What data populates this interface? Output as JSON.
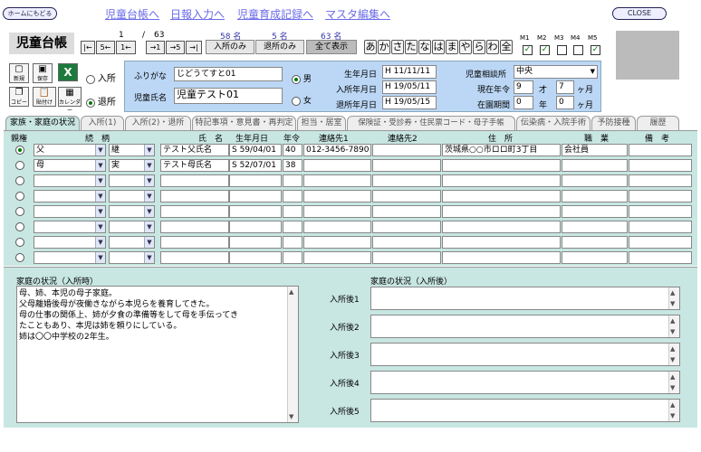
{
  "header": {
    "home_label": "ホームにもどる",
    "close_label": "CLOSE",
    "links": [
      "児童台帳へ",
      "日報入力へ",
      "児童育成記録へ",
      "マスタ編集へ"
    ]
  },
  "title": "児童台帳",
  "paging": {
    "current": "1",
    "sep": "/",
    "total": "63",
    "btn_first": "|←",
    "btn_back5": "5←",
    "btn_prev": "1←",
    "btn_next": "→1",
    "btn_fwd5": "→5",
    "btn_last": "→|"
  },
  "filters": [
    {
      "count": "58 名",
      "label": "入所のみ"
    },
    {
      "count": "5 名",
      "label": "退所のみ"
    },
    {
      "count": "63 名",
      "label": "全て表示"
    }
  ],
  "kana": [
    "あ",
    "か",
    "さ",
    "た",
    "な",
    "は",
    "ま",
    "や",
    "ら",
    "わ",
    "全"
  ],
  "months": [
    {
      "label": "M1",
      "checked": true
    },
    {
      "label": "M2",
      "checked": true
    },
    {
      "label": "M3",
      "checked": false
    },
    {
      "label": "M4",
      "checked": false
    },
    {
      "label": "M5",
      "checked": true
    }
  ],
  "tools": {
    "new": "新規",
    "save": "保存",
    "excel": "X",
    "copy": "コピー",
    "paste": "貼付け",
    "calendar": "カレンダー"
  },
  "status": {
    "entry": "入所",
    "exit": "退所"
  },
  "profile": {
    "furigana_label": "ふりがな",
    "furigana": "じどうてすと01",
    "name_label": "児童氏名",
    "name": "児童テスト01",
    "male": "男",
    "female": "女",
    "birth_label": "生年月日",
    "birth": "H 11/11/11",
    "entry_label": "入所年月日",
    "entry": "H 19/05/11",
    "exit_label": "退所年月日",
    "exit": "H 19/05/15",
    "office_label": "児童相談所",
    "office": "中央",
    "age_label": "現在年令",
    "age_y": "9",
    "age_y_unit": "才",
    "age_m": "7",
    "age_m_unit": "ヶ月",
    "stay_label": "在園期間",
    "stay_y": "0",
    "stay_y_unit": "年",
    "stay_m": "0",
    "stay_m_unit": "ヶ月"
  },
  "tabs": [
    "家族・家庭の状況",
    "入所(1)",
    "入所(2)・退所",
    "特記事項・意見書・再判定",
    "担当・居室",
    "保険証・受診券・住民票コード・母子手帳",
    "伝染病・入院手術",
    "予防接種",
    "履歴"
  ],
  "columns": [
    "親権",
    "続　柄",
    "氏　名",
    "生年月日",
    "年令",
    "連絡先1",
    "連絡先2",
    "住　所",
    "職　業",
    "備　考"
  ],
  "rows": [
    {
      "rel": "父",
      "rel2": "継",
      "name": "テスト父氏名",
      "birth": "S 59/04/01",
      "age": "40",
      "tel1": "012-3456-7890",
      "tel2": "",
      "addr": "茨城県○○市ロロ町3丁目",
      "job": "会社員",
      "note": ""
    },
    {
      "rel": "母",
      "rel2": "実",
      "name": "テスト母氏名",
      "birth": "S 52/07/01",
      "age": "38",
      "tel1": "",
      "tel2": "",
      "addr": "",
      "job": "",
      "note": ""
    },
    {
      "rel": "",
      "rel2": "",
      "name": "",
      "birth": "",
      "age": "",
      "tel1": "",
      "tel2": "",
      "addr": "",
      "job": "",
      "note": ""
    },
    {
      "rel": "",
      "rel2": "",
      "name": "",
      "birth": "",
      "age": "",
      "tel1": "",
      "tel2": "",
      "addr": "",
      "job": "",
      "note": ""
    },
    {
      "rel": "",
      "rel2": "",
      "name": "",
      "birth": "",
      "age": "",
      "tel1": "",
      "tel2": "",
      "addr": "",
      "job": "",
      "note": ""
    },
    {
      "rel": "",
      "rel2": "",
      "name": "",
      "birth": "",
      "age": "",
      "tel1": "",
      "tel2": "",
      "addr": "",
      "job": "",
      "note": ""
    },
    {
      "rel": "",
      "rel2": "",
      "name": "",
      "birth": "",
      "age": "",
      "tel1": "",
      "tel2": "",
      "addr": "",
      "job": "",
      "note": ""
    },
    {
      "rel": "",
      "rel2": "",
      "name": "",
      "birth": "",
      "age": "",
      "tel1": "",
      "tel2": "",
      "addr": "",
      "job": "",
      "note": ""
    }
  ],
  "home_before": {
    "label": "家庭の状況（入所時）",
    "lines": [
      "母、姉、本児の母子家庭。",
      "父母離婚後母が夜働きながら本児らを養育してきた。",
      "母の仕事の関係上、姉が夕食の準備等をして母を手伝ってき",
      "たこともあり、本児は姉を頼りにしている。",
      "姉は〇〇中学校の2年生。"
    ]
  },
  "home_after": {
    "label": "家庭の状況（入所後）",
    "items": [
      "入所後1",
      "入所後2",
      "入所後3",
      "入所後4",
      "入所後5"
    ]
  }
}
